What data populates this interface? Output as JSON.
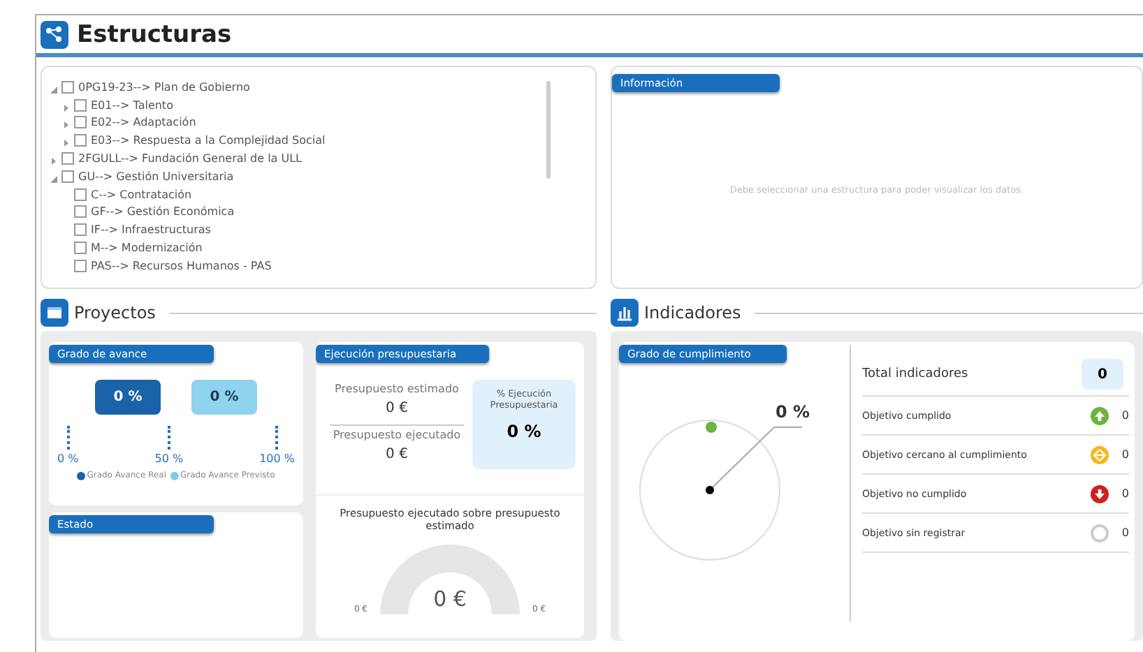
{
  "header": {
    "title": "Estructuras"
  },
  "tree": [
    {
      "label": "0PG19-23--> Plan de Gobierno",
      "checked": false,
      "expanded": true,
      "children": [
        {
          "label": "E01--> Talento",
          "checked": false,
          "expanded": false
        },
        {
          "label": "E02--> Adaptación",
          "checked": false,
          "expanded": false
        },
        {
          "label": "E03--> Respuesta a la Complejidad Social",
          "checked": false,
          "expanded": false
        }
      ]
    },
    {
      "label": "2FGULL--> Fundación General de la ULL",
      "checked": false,
      "expanded": false
    },
    {
      "label": "GU--> Gestión Universitaria",
      "checked": false,
      "expanded": true,
      "children": [
        {
          "label": "C--> Contratación",
          "checked": false
        },
        {
          "label": "GF--> Gestión Económica",
          "checked": false
        },
        {
          "label": "IF--> Infraestructuras",
          "checked": false
        },
        {
          "label": "M--> Modernización",
          "checked": false
        },
        {
          "label": "PAS--> Recursos Humanos - PAS",
          "checked": false
        }
      ]
    }
  ],
  "info": {
    "tab": "Información",
    "message": "Debe seleccionar una estructura para poder visualizar los datos."
  },
  "proyectos": {
    "title": "Proyectos",
    "avance": {
      "tab": "Grado de avance",
      "real": "0 %",
      "previsto": "0 %",
      "scale": [
        "0 %",
        "50 %",
        "100 %"
      ],
      "legend": [
        {
          "label": "Grado Avance Real",
          "color": "#1a63a8"
        },
        {
          "label": "Grado Avance Previsto",
          "color": "#7fcbe6"
        }
      ]
    },
    "estado": {
      "tab": "Estado"
    },
    "ejecucion": {
      "tab": "Ejecución presupuestaria",
      "estimado_label": "Presupuesto estimado",
      "estimado": "0 €",
      "ejecutado_label": "Presupuesto ejecutado",
      "ejecutado": "0 €",
      "pct_label": "% Ejecución Presupuestaria",
      "pct": "0 %",
      "gauge_title": "Presupuesto ejecutado sobre presupuesto estimado",
      "gauge_value": "0 €",
      "gauge_min": "0 €",
      "gauge_max": "0 €"
    }
  },
  "indicadores": {
    "title": "Indicadores",
    "tab": "Grado de cumplimiento",
    "dial_value": "0 %",
    "total_label": "Total indicadores",
    "total": "0",
    "rows": [
      {
        "label": "Objetivo cumplido",
        "count": "0",
        "kind": "up",
        "color": "#6db33f"
      },
      {
        "label": "Objetivo cercano al cumplimiento",
        "count": "0",
        "kind": "near",
        "color": "#f4b619"
      },
      {
        "label": "Objetivo no cumplido",
        "count": "0",
        "kind": "down",
        "color": "#d01f1f"
      },
      {
        "label": "Objetivo sin registrar",
        "count": "0",
        "kind": "none",
        "color": "#cccccc"
      }
    ]
  }
}
